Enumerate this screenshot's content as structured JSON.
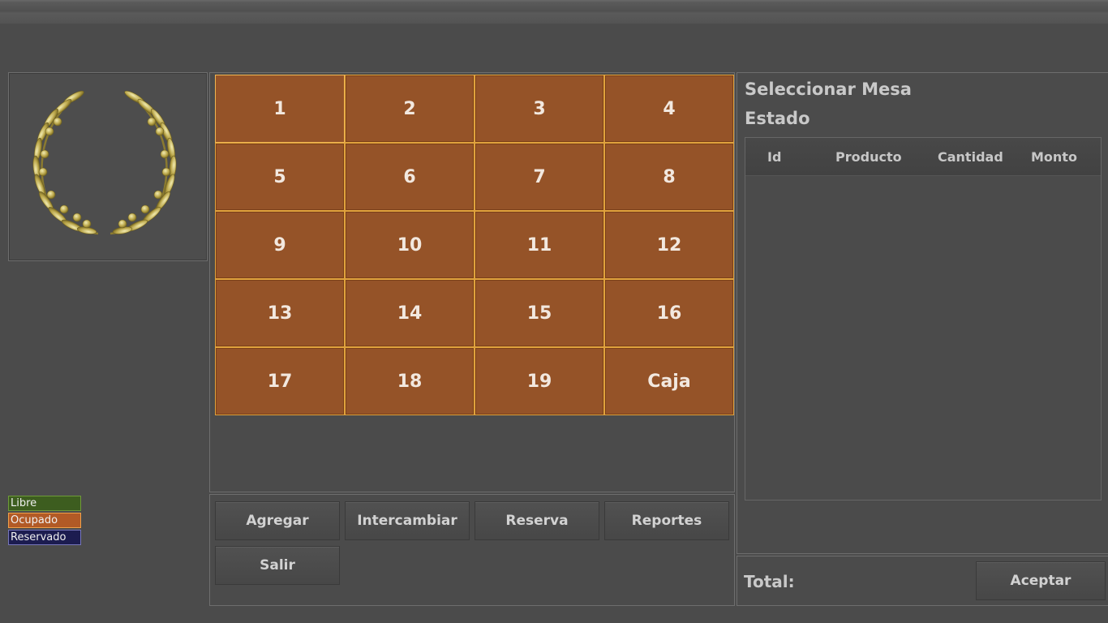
{
  "legend": {
    "libre": "Libre",
    "ocupado": "Ocupado",
    "reservado": "Reservado"
  },
  "mesas": [
    "1",
    "2",
    "3",
    "4",
    "5",
    "6",
    "7",
    "8",
    "9",
    "10",
    "11",
    "12",
    "13",
    "14",
    "15",
    "16",
    "17",
    "18",
    "19",
    "Caja"
  ],
  "buttons": {
    "agregar": "Agregar",
    "intercambiar": "Intercambiar",
    "reserva": "Reserva",
    "reportes": "Reportes",
    "salir": "Salir",
    "aceptar": "Aceptar"
  },
  "panel": {
    "title": "Seleccionar Mesa",
    "estado": "Estado",
    "columns": {
      "id": "Id",
      "producto": "Producto",
      "cantidad": "Cantidad",
      "monto": "Monto"
    },
    "total_label": "Total:"
  },
  "colors": {
    "ocupado": "#955328",
    "libre": "#3d5d1f",
    "reservado": "#1c1c50"
  }
}
